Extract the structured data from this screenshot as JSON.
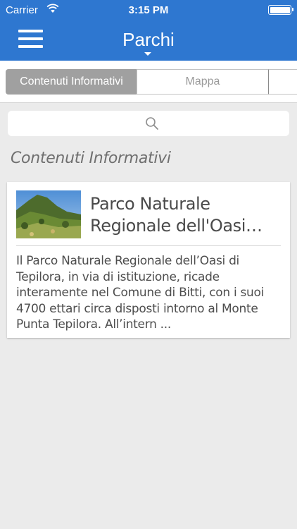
{
  "status_bar": {
    "carrier": "Carrier",
    "time": "3:15 PM"
  },
  "nav": {
    "title": "Parchi",
    "menu_icon": "hamburger-menu-icon"
  },
  "tabs": [
    {
      "label": "Contenuti Informativi",
      "selected": true
    },
    {
      "label": "Mappa",
      "selected": false
    },
    {
      "label": "",
      "selected": false
    }
  ],
  "search": {
    "icon": "search-icon"
  },
  "section": {
    "title": "Contenuti Informativi"
  },
  "items": [
    {
      "title": "Parco Naturale Regionale dell'Oasi…",
      "description": "Il Parco Naturale Regionale dell’Oasi di Tepilora, in via di istituzione, ricade interamente nel Comune di Bitti, con i suoi 4700 ettari circa disposti intorno al Monte Punta Tepilora. All’intern ..."
    }
  ],
  "colors": {
    "accent": "#2e77d0",
    "background": "#ebebeb",
    "segment_selected": "#a0a0a0"
  }
}
